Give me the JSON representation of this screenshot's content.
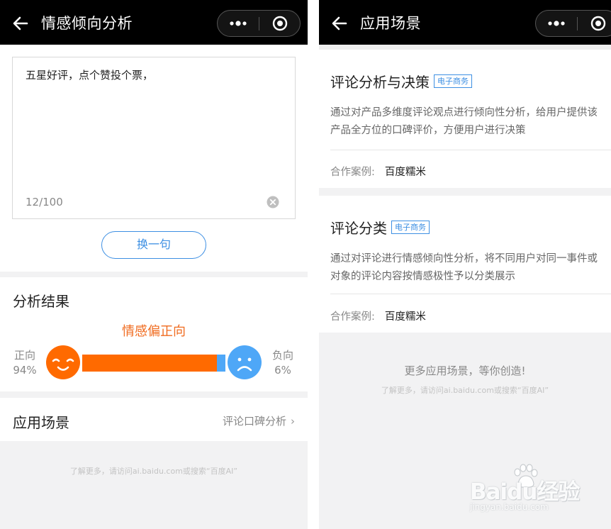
{
  "left": {
    "nav": {
      "title": "情感倾向分析"
    },
    "input": {
      "text": "五星好评，点个赞投个票，",
      "counter": "12/100"
    },
    "swap_button_label": "换一句",
    "result": {
      "title": "分析结果",
      "verdict": "情感偏正向",
      "positive_label": "正向",
      "positive_percent": "94%",
      "negative_label": "负向",
      "negative_percent": "6%",
      "positive_ratio": 0.94
    },
    "scene": {
      "title": "应用场景",
      "link": "评论口碑分析"
    },
    "footer": "了解更多，请访问ai.baidu.com或搜索“百度AI”"
  },
  "right": {
    "nav": {
      "title": "应用场景"
    },
    "cases": [
      {
        "title": "评论分析与决策",
        "tag": "电子商务",
        "description": "通过对产品多维度评论观点进行倾向性分析，给用户提供该产品全方位的口碑评价，方便用户进行决策",
        "partner_label": "合作案例:",
        "partner_name": "百度糯米"
      },
      {
        "title": "评论分类",
        "tag": "电子商务",
        "description": "通过对评论进行情感倾向性分析，将不同用户对同一事件或对象的评论内容按情感极性予以分类展示",
        "partner_label": "合作案例:",
        "partner_name": "百度糯米"
      }
    ],
    "more": "更多应用场景，等你创造!",
    "footer": "了解更多，请访问ai.baidu.com或搜索“百度AI”"
  },
  "watermark": {
    "logo": "Baidu经验",
    "url": "jingyan.baidu.com"
  },
  "colors": {
    "accent_blue": "#3d8fe3",
    "positive_orange": "#ff6a00",
    "negative_blue": "#4ea7f7",
    "navbar": "#000000"
  },
  "icons": [
    "back-arrow-icon",
    "more-dots-icon",
    "close-target-icon",
    "clear-icon",
    "happy-face-icon",
    "sad-face-icon",
    "chevron-right-icon"
  ]
}
